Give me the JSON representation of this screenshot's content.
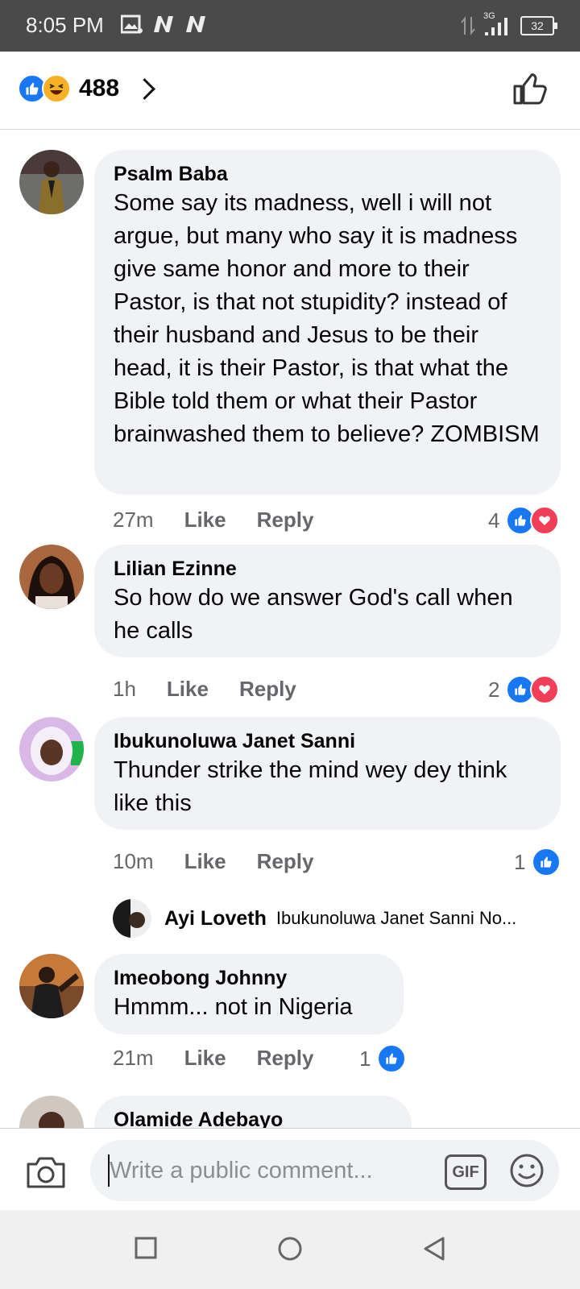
{
  "status_bar": {
    "time": "8:05 PM",
    "network": "3G",
    "battery": "32"
  },
  "header": {
    "reaction_count": "488",
    "reactions": [
      "like",
      "haha"
    ]
  },
  "comments": [
    {
      "author": "Psalm Baba",
      "text": "Some say its madness, well i will not argue, but many who say it is madness give same honor and more to their Pastor, is that not stupidity? instead of their husband and Jesus to be their head, it is their Pastor, is that what the Bible told them or what their Pastor brainwashed them to believe? ZOMBISM",
      "time": "27m",
      "like": "Like",
      "reply": "Reply",
      "reaction_count": "4",
      "reactions": [
        "like",
        "love"
      ]
    },
    {
      "author": "Lilian Ezinne",
      "text": "So how do we answer God's call when he calls",
      "time": "1h",
      "like": "Like",
      "reply": "Reply",
      "reaction_count": "2",
      "reactions": [
        "like",
        "love"
      ]
    },
    {
      "author": "Ibukunoluwa Janet Sanni",
      "text": "Thunder strike the mind wey dey think like this",
      "time": "10m",
      "like": "Like",
      "reply": "Reply",
      "reaction_count": "1",
      "reactions": [
        "like"
      ],
      "reply_preview": {
        "author": "Ayi Loveth",
        "text": "Ibukunoluwa Janet Sanni No..."
      }
    },
    {
      "author": "Imeobong Johnny",
      "text": "Hmmm... not in Nigeria",
      "time": "21m",
      "like": "Like",
      "reply": "Reply",
      "reaction_count": "1",
      "reactions": [
        "like"
      ]
    },
    {
      "author": "Olamide Adebayo"
    }
  ],
  "composer": {
    "placeholder": "Write a public comment...",
    "gif_label": "GIF"
  },
  "colors": {
    "facebook_blue": "#1877f2",
    "love_red": "#f33e58",
    "bubble_gray": "#f0f2f5"
  }
}
